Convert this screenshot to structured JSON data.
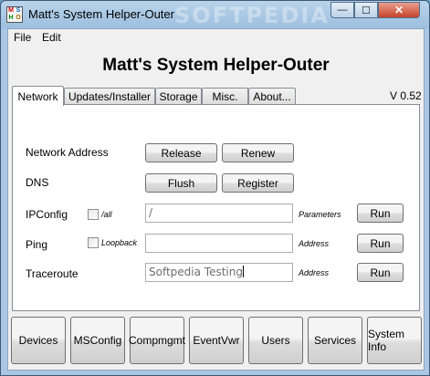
{
  "window": {
    "title": "Matt's System Helper-Outer",
    "watermark": "SOFTPEDIA",
    "icon_letters": [
      "M",
      "S",
      "H",
      "O"
    ],
    "controls": {
      "minimize": "—",
      "maximize": "☐",
      "close": "✕"
    }
  },
  "menu": {
    "file": "File",
    "edit": "Edit"
  },
  "heading": "Matt's System Helper-Outer",
  "version": "V 0.52",
  "tabs": [
    {
      "label": "Network",
      "active": true
    },
    {
      "label": "Updates/Installer",
      "active": false
    },
    {
      "label": "Storage",
      "active": false
    },
    {
      "label": "Misc.",
      "active": false
    },
    {
      "label": "About...",
      "active": false
    }
  ],
  "network": {
    "network_address": {
      "label": "Network Address",
      "release": "Release",
      "renew": "Renew"
    },
    "dns": {
      "label": "DNS",
      "flush": "Flush",
      "register": "Register"
    },
    "ipconfig": {
      "label": "IPConfig",
      "checkbox_label": "/all",
      "checked": false,
      "value": "/",
      "param_label": "Parameters",
      "run": "Run"
    },
    "ping": {
      "label": "Ping",
      "checkbox_label": "Loopback",
      "checked": false,
      "value": "",
      "param_label": "Address",
      "run": "Run"
    },
    "traceroute": {
      "label": "Traceroute",
      "value": "Softpedia Testing",
      "param_label": "Address",
      "run": "Run"
    }
  },
  "bottom_buttons": [
    "Devices",
    "MSConfig",
    "Compmgmt",
    "EventVwr",
    "Users",
    "Services",
    "System Info"
  ],
  "colors": {
    "titlebar": "#9dbfdf",
    "close_button": "#c7432a",
    "client_bg": "#f0f0f0",
    "panel_bg": "#ffffff"
  }
}
